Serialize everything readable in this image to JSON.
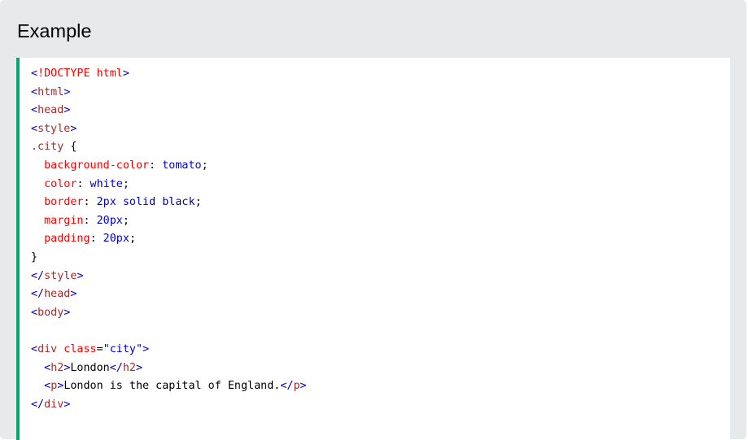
{
  "panel": {
    "title": "Example"
  },
  "code": {
    "doctype_open": "<",
    "doctype_text": "!DOCTYPE",
    "doctype_attr": " html",
    "doctype_close": ">",
    "lt": "<",
    "gt": ">",
    "lt_slash": "</",
    "tag_html": "html",
    "tag_head": "head",
    "tag_style": "style",
    "tag_body": "body",
    "tag_div": "div",
    "tag_h2": "h2",
    "tag_p": "p",
    "selector": ".city",
    "brace_open": " {",
    "brace_close": "}",
    "indent": "  ",
    "colon": ":",
    "semicolon": ";",
    "decl": [
      {
        "prop": "background-color",
        "value": " tomato"
      },
      {
        "prop": "color",
        "value": " white"
      },
      {
        "prop": "border",
        "value": " 2px solid black"
      },
      {
        "prop": "margin",
        "value": " 20px"
      },
      {
        "prop": "padding",
        "value": " 20px"
      }
    ],
    "div_attr_name": " class",
    "div_attr_eq": "=",
    "div_attr_value": "\"city\"",
    "h2_text": "London",
    "p_text": "London is the capital of England."
  },
  "colors": {
    "accent": "#04aa6d",
    "panel_bg": "#e7e9eb",
    "bracket": "#0000cd",
    "tag": "#a52a2a",
    "attr": "#ff0000"
  }
}
